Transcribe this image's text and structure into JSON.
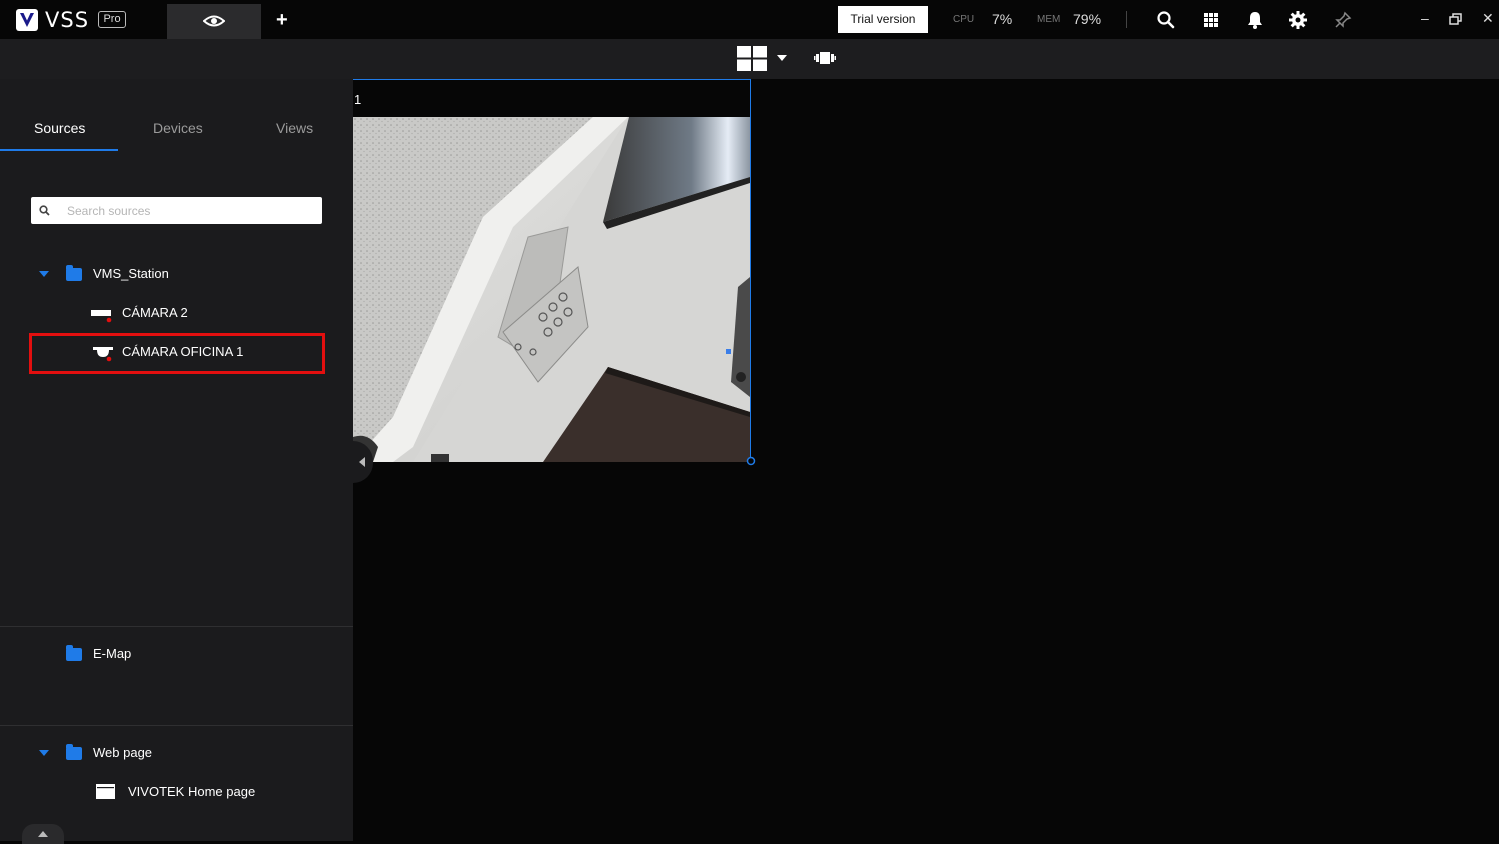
{
  "app": {
    "logo_text": "VSS",
    "edition_badge": "Pro",
    "trial_label": "Trial version"
  },
  "stats": {
    "cpu_label": "CPU",
    "cpu_value": "7%",
    "mem_label": "MEM",
    "mem_value": "79%"
  },
  "header_icons": [
    "eye-icon",
    "plus-icon",
    "search-icon",
    "apps-grid-icon",
    "bell-icon",
    "gear-icon",
    "pin-icon",
    "minimize-icon",
    "restore-icon",
    "close-icon"
  ],
  "toolbar_icons": [
    "layout-grid-icon",
    "dropdown-arrow-icon",
    "sequence-icon"
  ],
  "sidebar": {
    "tabs": [
      {
        "label": "Sources",
        "active": true
      },
      {
        "label": "Devices",
        "active": false
      },
      {
        "label": "Views",
        "active": false
      }
    ],
    "search_placeholder": "Search sources",
    "tree": {
      "station": "VMS_Station",
      "cameras": [
        "CÁMARA 2",
        "CÁMARA OFICINA 1"
      ],
      "emap": "E-Map",
      "webpage_group": "Web page",
      "webpage_item": "VIVOTEK Home page"
    }
  },
  "view": {
    "cell_number": "1"
  },
  "colors": {
    "accent": "#1f7be8",
    "highlight": "#e30f0f",
    "panel": "#1b1b1d",
    "background": "#060606"
  }
}
